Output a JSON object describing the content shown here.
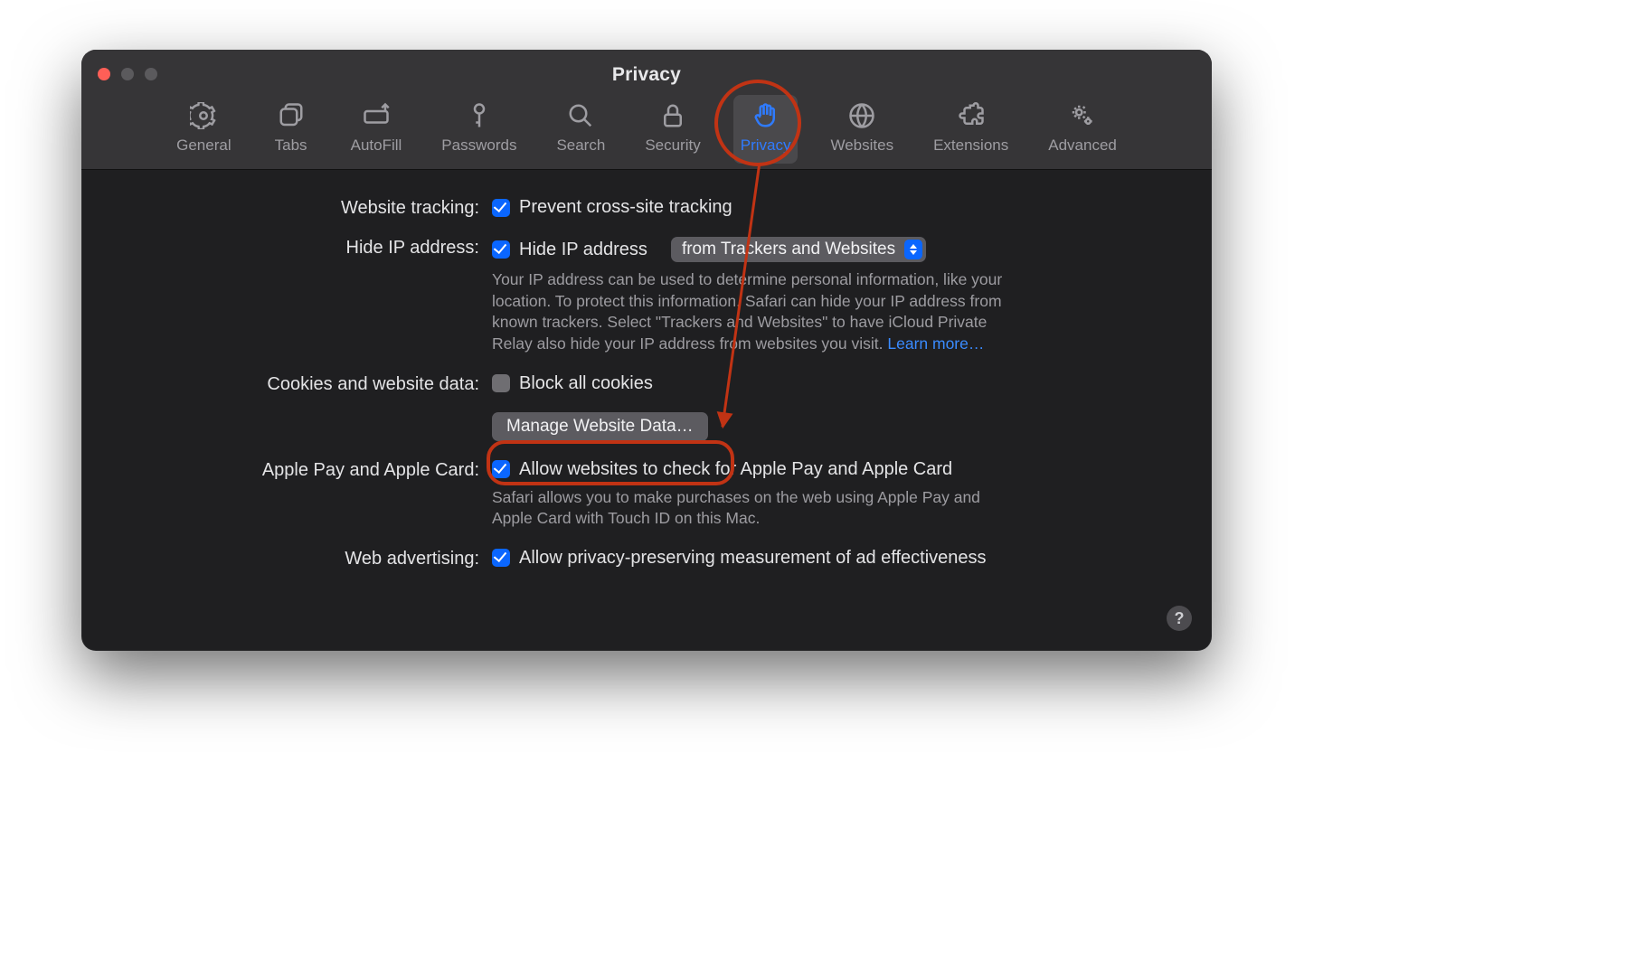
{
  "window": {
    "title": "Privacy"
  },
  "toolbar": {
    "items": [
      {
        "label": "General",
        "active": false,
        "icon": "gear-icon"
      },
      {
        "label": "Tabs",
        "active": false,
        "icon": "tabs-icon"
      },
      {
        "label": "AutoFill",
        "active": false,
        "icon": "autofill-icon"
      },
      {
        "label": "Passwords",
        "active": false,
        "icon": "key-icon"
      },
      {
        "label": "Search",
        "active": false,
        "icon": "search-icon"
      },
      {
        "label": "Security",
        "active": false,
        "icon": "lock-icon"
      },
      {
        "label": "Privacy",
        "active": true,
        "icon": "hand-icon"
      },
      {
        "label": "Websites",
        "active": false,
        "icon": "globe-icon"
      },
      {
        "label": "Extensions",
        "active": false,
        "icon": "puzzle-icon"
      },
      {
        "label": "Advanced",
        "active": false,
        "icon": "gears-icon"
      }
    ]
  },
  "rows": {
    "tracking": {
      "label": "Website tracking:",
      "checkbox_checked": true,
      "text": "Prevent cross-site tracking"
    },
    "hideip": {
      "label": "Hide IP address:",
      "checkbox_checked": true,
      "text": "Hide IP address",
      "popup_value": "from Trackers and Websites",
      "desc": "Your IP address can be used to determine personal information, like your location. To protect this information, Safari can hide your IP address from known trackers. Select \"Trackers and Websites\" to have iCloud Private Relay also hide your IP address from websites you visit. ",
      "learn_more": "Learn more…"
    },
    "cookies": {
      "label": "Cookies and website data:",
      "checkbox_checked": false,
      "text": "Block all cookies",
      "button": "Manage Website Data…"
    },
    "applepay": {
      "label": "Apple Pay and Apple Card:",
      "checkbox_checked": true,
      "text": "Allow websites to check for Apple Pay and Apple Card",
      "desc": "Safari allows you to make purchases on the web using Apple Pay and Apple Card with Touch ID on this Mac."
    },
    "webad": {
      "label": "Web advertising:",
      "checkbox_checked": true,
      "text": "Allow privacy-preserving measurement of ad effectiveness"
    }
  },
  "help": {
    "label": "?"
  },
  "annotations": {
    "circle_on": "privacy-tab",
    "arrow_to": "manage-website-data-button",
    "rect_on": "manage-website-data-button"
  }
}
